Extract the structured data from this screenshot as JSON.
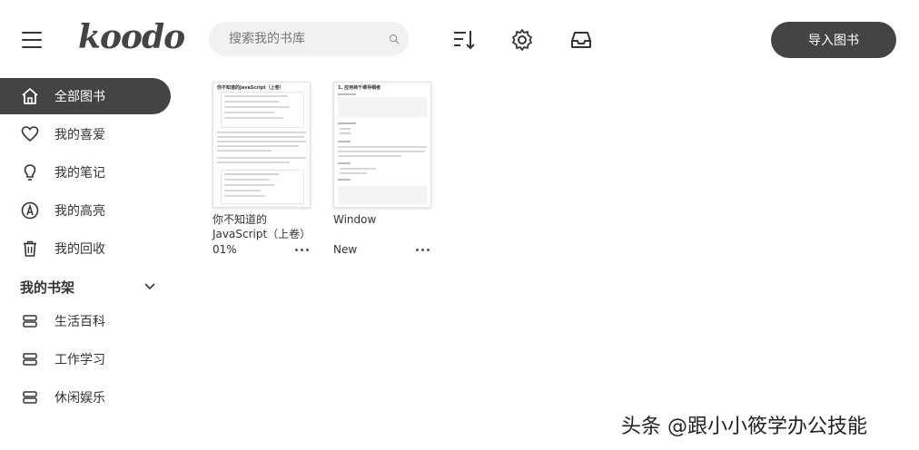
{
  "header": {
    "logo": "koodo",
    "search_placeholder": "搜索我的书库",
    "import_label": "导入图书",
    "icons": [
      "menu-icon",
      "search-icon",
      "sort-icon",
      "settings-icon",
      "inbox-icon"
    ]
  },
  "sidebar": {
    "items": [
      {
        "label": "全部图书",
        "icon": "home-icon",
        "active": true
      },
      {
        "label": "我的喜爱",
        "icon": "heart-icon"
      },
      {
        "label": "我的笔记",
        "icon": "lightbulb-icon"
      },
      {
        "label": "我的高亮",
        "icon": "highlight-icon"
      },
      {
        "label": "我的回收",
        "icon": "trash-icon"
      }
    ],
    "shelf_title": "我的书架",
    "shelves": [
      {
        "label": "生活百科",
        "icon": "shelf-icon"
      },
      {
        "label": "工作学习",
        "icon": "shelf-icon"
      },
      {
        "label": "休闲娱乐",
        "icon": "shelf-icon"
      }
    ]
  },
  "books": [
    {
      "title": "你不知道的JavaScript（上卷）",
      "progress": "01%",
      "cover_heading": "你不知道的JavaScript（上卷）"
    },
    {
      "title": "Window",
      "progress": "New",
      "cover_heading": "1. 应用商千维导细者"
    }
  ],
  "watermark": "头条 @跟小小筱学办公技能",
  "colors": {
    "accent": "#444444",
    "search_bg": "#f1f1f1",
    "text": "#333333"
  }
}
